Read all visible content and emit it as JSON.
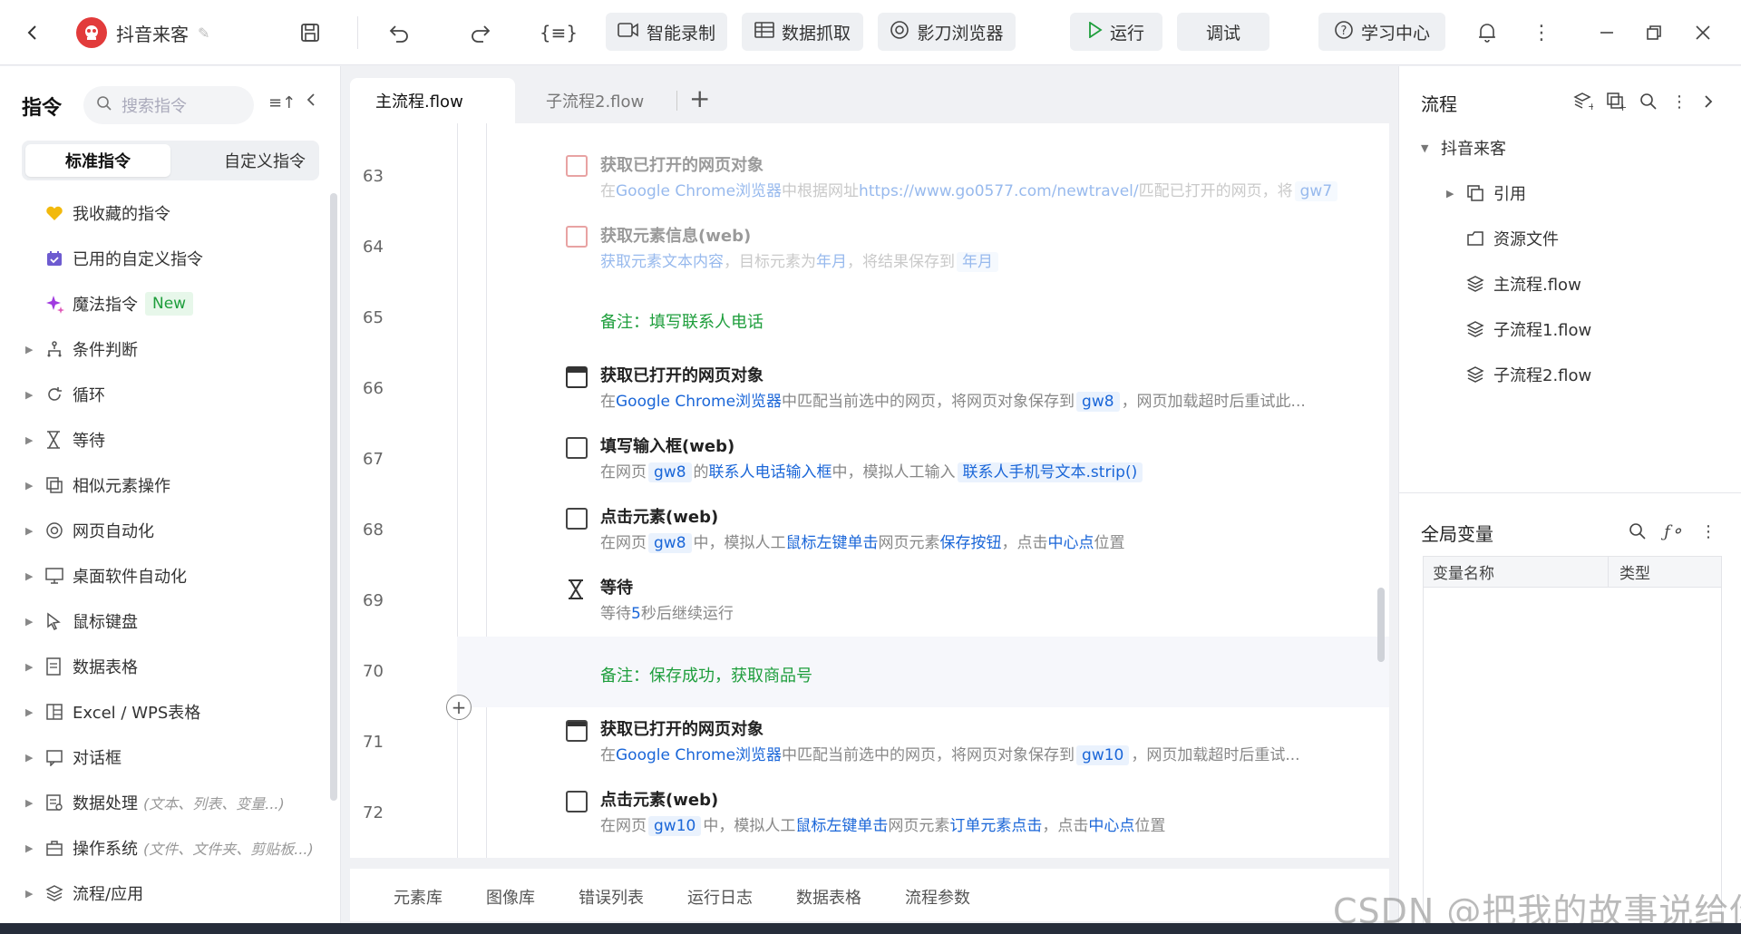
{
  "titlebar": {
    "app_name": "抖音来客",
    "buttons": {
      "smart_record": "智能录制",
      "data_grab": "数据抓取",
      "browser": "影刀浏览器",
      "run": "运行",
      "debug": "调试",
      "learning_center": "学习中心"
    },
    "icons": [
      "back-icon",
      "app-logo-icon",
      "edit-icon",
      "save-icon",
      "undo-icon",
      "redo-icon",
      "code-icon",
      "record-icon",
      "table-icon",
      "browser-icon",
      "play-icon",
      "help-icon",
      "bell-icon",
      "more-icon",
      "minimize-icon",
      "restore-icon",
      "close-icon"
    ]
  },
  "left_panel": {
    "title": "指令",
    "search_placeholder": "搜索指令",
    "tabs": {
      "standard": "标准指令",
      "custom": "自定义指令"
    },
    "favorites": "我收藏的指令",
    "used_custom": "已用的自定义指令",
    "magic": "魔法指令",
    "new_badge": "New",
    "categories": [
      {
        "label": "条件判断",
        "hint": ""
      },
      {
        "label": "循环",
        "hint": ""
      },
      {
        "label": "等待",
        "hint": ""
      },
      {
        "label": "相似元素操作",
        "hint": ""
      },
      {
        "label": "网页自动化",
        "hint": ""
      },
      {
        "label": "桌面软件自动化",
        "hint": ""
      },
      {
        "label": "鼠标键盘",
        "hint": ""
      },
      {
        "label": "数据表格",
        "hint": ""
      },
      {
        "label": "Excel / WPS表格",
        "hint": ""
      },
      {
        "label": "对话框",
        "hint": ""
      },
      {
        "label": "数据处理",
        "hint": "(文本、列表、变量...)"
      },
      {
        "label": "操作系统",
        "hint": "(文件、文件夹、剪贴板...)"
      },
      {
        "label": "流程/应用",
        "hint": ""
      }
    ]
  },
  "editor": {
    "tabs": [
      "主流程.flow",
      "子流程2.flow"
    ],
    "add_tab": "+",
    "lines": {
      "l63": {
        "num": "63",
        "title": "获取已打开的网页对象",
        "d1": "在",
        "d2": "Google Chrome浏览器",
        "d3": "中根据网址",
        "d4": "https://www.go0577.com/newtravel/",
        "d5": "匹配已打开的网页，将",
        "d6": "gw7"
      },
      "l64": {
        "num": "64",
        "title": "获取元素信息(web)",
        "d1": "获取元素文本内容",
        "d2": "，目标元素为",
        "d3": "年月",
        "d4": "，将结果保存到",
        "d5": "年月"
      },
      "l65": {
        "num": "65",
        "note": "备注：填写联系人电话"
      },
      "l66": {
        "num": "66",
        "title": "获取已打开的网页对象",
        "d1": "在",
        "d2": "Google Chrome浏览器",
        "d3": "中匹配当前选中的网页，将网页对象保存到",
        "d4": "gw8",
        "d5": "，网页加载超时后重试此..."
      },
      "l67": {
        "num": "67",
        "title": "填写输入框(web)",
        "d1": "在网页",
        "d2": "gw8",
        "d3": "的",
        "d4": "联系人电话输入框",
        "d5": "中，模拟人工输入",
        "d6": "联系人手机号文本.strip()"
      },
      "l68": {
        "num": "68",
        "title": "点击元素(web)",
        "d1": "在网页",
        "d2": "gw8",
        "d3": "中，模拟人工",
        "d4": "鼠标左键单击",
        "d5": "网页元素",
        "d6": "保存按钮",
        "d7": "，点击",
        "d8": "中心点",
        "d9": "位置"
      },
      "l69": {
        "num": "69",
        "title": "等待",
        "d1": "等待",
        "d2": "5",
        "d3": "秒后继续运行"
      },
      "l70": {
        "num": "70",
        "note": "备注：保存成功，获取商品号"
      },
      "l71": {
        "num": "71",
        "title": "获取已打开的网页对象",
        "d1": "在",
        "d2": "Google Chrome浏览器",
        "d3": "中匹配当前选中的网页，将网页对象保存到",
        "d4": "gw10",
        "d5": "，网页加载超时后重试..."
      },
      "l72": {
        "num": "72",
        "title": "点击元素(web)",
        "d1": "在网页",
        "d2": "gw10",
        "d3": "中，模拟人工",
        "d4": "鼠标左键单击",
        "d5": "网页元素",
        "d6": "订单元素点击",
        "d7": "，点击",
        "d8": "中心点",
        "d9": "位置"
      }
    }
  },
  "bottom_tabs": [
    "元素库",
    "图像库",
    "错误列表",
    "运行日志",
    "数据表格",
    "流程参数"
  ],
  "watermark": "CSDN @把我的故事说给你",
  "right_panel": {
    "flow_title": "流程",
    "tree": {
      "root": "抖音来客",
      "ref": "引用",
      "resources": "资源文件",
      "main": "主流程.flow",
      "sub1": "子流程1.flow",
      "sub2": "子流程2.flow"
    },
    "globals_title": "全局变量",
    "var_headers": {
      "name": "变量名称",
      "type": "类型"
    }
  }
}
